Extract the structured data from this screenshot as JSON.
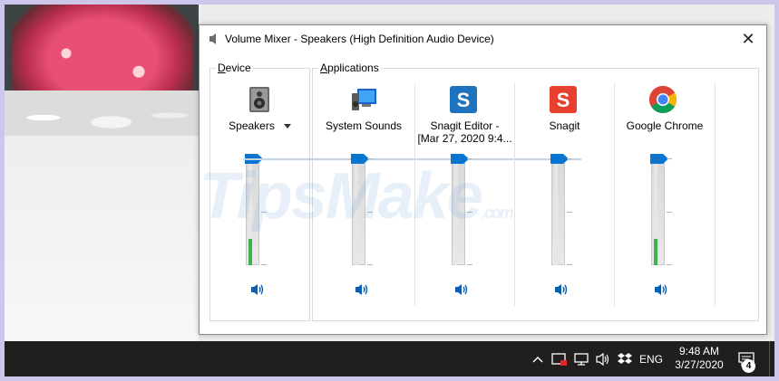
{
  "window": {
    "title": "Volume Mixer - Speakers (High Definition Audio Device)",
    "close_glyph": "✕"
  },
  "device_group": {
    "label_accel": "D",
    "label_rest": "evice",
    "channel": {
      "label": "Speakers",
      "icon": "speaker-device-icon",
      "volume": 1.0,
      "peak": 0.25
    }
  },
  "apps_group": {
    "label_accel": "A",
    "label_rest": "pplications",
    "channels": [
      {
        "label": "System Sounds",
        "label2": "",
        "icon": "system-sounds-icon",
        "volume": 1.0,
        "peak": 0.0
      },
      {
        "label": "Snagit Editor -",
        "label2": "[Mar 27, 2020 9:4...",
        "icon": "snagit-editor-icon",
        "volume": 1.0,
        "peak": 0.0
      },
      {
        "label": "Snagit",
        "label2": "",
        "icon": "snagit-icon",
        "volume": 1.0,
        "peak": 0.0
      },
      {
        "label": "Google Chrome",
        "label2": "",
        "icon": "chrome-icon",
        "volume": 1.0,
        "peak": 0.25
      }
    ]
  },
  "taskbar": {
    "lang": "ENG",
    "time": "9:48 AM",
    "date": "3/27/2020",
    "notification_count": "4"
  },
  "watermark": {
    "main": "TipsMake",
    "suffix": ".com"
  },
  "colors": {
    "accent": "#0a74d1",
    "peak": "#3fb24a",
    "taskbar": "#201f1e"
  }
}
